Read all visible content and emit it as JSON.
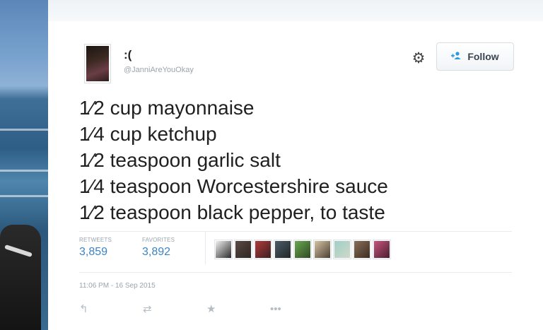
{
  "tweet": {
    "display_name": ":(",
    "handle": "@JanniAreYouOkay",
    "follow_label": "Follow",
    "lines": [
      "1⁄2 cup mayonnaise",
      "1⁄4 cup ketchup",
      "1⁄2 teaspoon garlic salt",
      "1⁄4 teaspoon Worcestershire sauce",
      "1⁄2 teaspoon black pepper, to taste"
    ],
    "stats": {
      "retweets_label": "RETWEETS",
      "retweets_count": "3,859",
      "favorites_label": "FAVORITES",
      "favorites_count": "3,892"
    },
    "timestamp": "11:06 PM - 16 Sep 2015"
  },
  "icons": {
    "gear": "gear-icon",
    "follow": "add-user-icon",
    "reply": "reply-icon",
    "retweet": "retweet-icon",
    "favorite": "star-icon",
    "more": "more-icon"
  },
  "colors": {
    "link_blue": "#3b84c4",
    "follow_icon": "#2b9ae0",
    "muted_text": "#9aa4ae"
  }
}
